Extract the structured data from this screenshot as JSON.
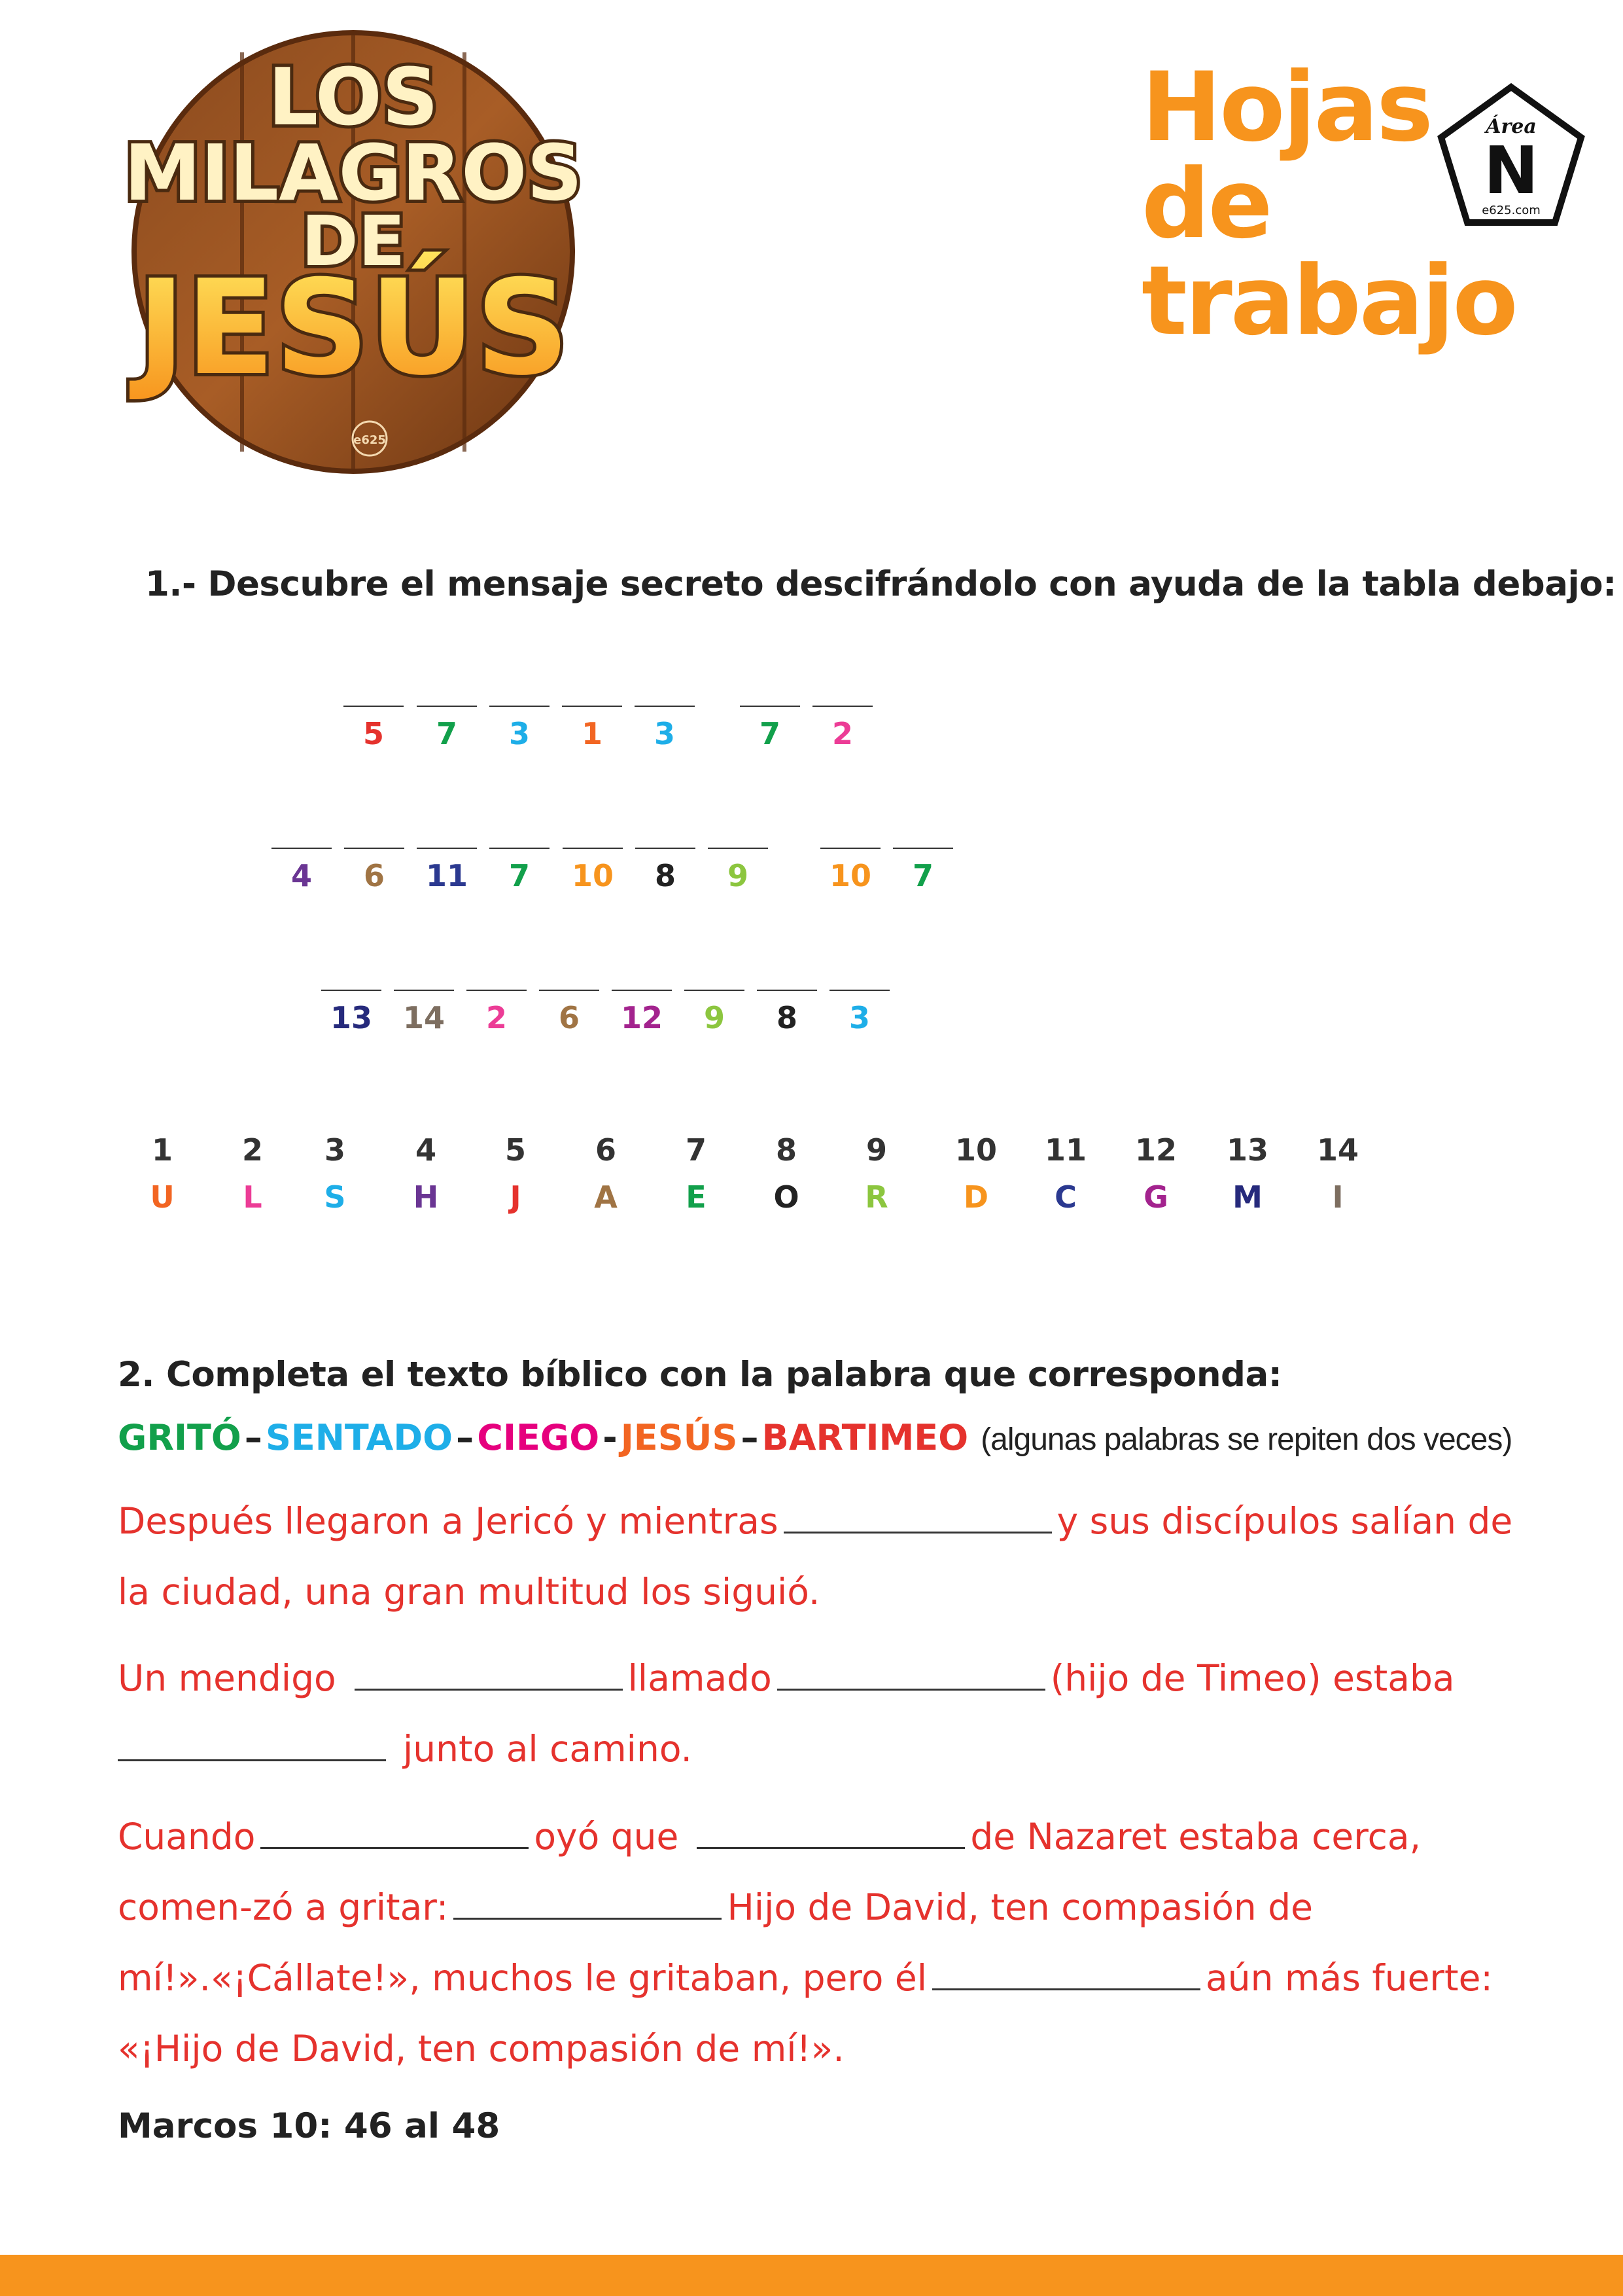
{
  "header": {
    "logo": {
      "line1": "LOS",
      "line2": "MILAGROS",
      "line3": "DE",
      "line4": "JESÚS",
      "mark": "e625"
    },
    "title_lines": [
      "Hojas",
      "de",
      "trabajo"
    ],
    "badge": {
      "top": "Área",
      "letter": "N",
      "bottom": "e625.com"
    }
  },
  "section1": {
    "instruction": "1.- Descubre el mensaje secreto descifrándolo con ayuda de la tabla debajo:",
    "rows": [
      [
        "5",
        "7",
        "3",
        "1",
        "3",
        "7",
        "2"
      ],
      [
        "4",
        "6",
        "11",
        "7",
        "10",
        "8",
        "9",
        "10",
        "7"
      ],
      [
        "13",
        "14",
        "2",
        "6",
        "12",
        "9",
        "8",
        "3"
      ]
    ],
    "key": [
      {
        "num": "1",
        "letter": "U",
        "color": "#f26522"
      },
      {
        "num": "2",
        "letter": "L",
        "color": "#ec3c96"
      },
      {
        "num": "3",
        "letter": "S",
        "color": "#1eaee8"
      },
      {
        "num": "4",
        "letter": "H",
        "color": "#6a3593"
      },
      {
        "num": "5",
        "letter": "J",
        "color": "#e5322d"
      },
      {
        "num": "6",
        "letter": "A",
        "color": "#a07444"
      },
      {
        "num": "7",
        "letter": "E",
        "color": "#12a04b"
      },
      {
        "num": "8",
        "letter": "O",
        "color": "#222222"
      },
      {
        "num": "9",
        "letter": "R",
        "color": "#8cc63f"
      },
      {
        "num": "10",
        "letter": "D",
        "color": "#f7941d"
      },
      {
        "num": "11",
        "letter": "C",
        "color": "#2b3990"
      },
      {
        "num": "12",
        "letter": "G",
        "color": "#a3238e"
      },
      {
        "num": "13",
        "letter": "M",
        "color": "#262a7c"
      },
      {
        "num": "14",
        "letter": "I",
        "color": "#7d6e60"
      }
    ]
  },
  "section2": {
    "instruction": "2. Completa el texto bíblico  con la palabra que corresponda:",
    "words": [
      {
        "text": "GRITÓ",
        "color": "#12a04b"
      },
      {
        "text": "SENTADO",
        "color": "#1eaee8"
      },
      {
        "text": "CIEGO",
        "color": "#e6007e"
      },
      {
        "text": "JESÚS",
        "color": "#f26522"
      },
      {
        "text": "BARTIMEO",
        "color": "#e5322d"
      }
    ],
    "separators": [
      "–",
      "–",
      "-",
      "–"
    ],
    "note": "(algunas palabras se repiten dos veces)",
    "p1": {
      "a": "Después llegaron a Jericó y mientras",
      "b": "y sus discípulos salían de la ciudad, una gran multitud los siguió."
    },
    "p2": {
      "a": "Un mendigo",
      "b": "llamado",
      "c": "(hijo de Timeo) estaba",
      "d": "junto al camino."
    },
    "p3": {
      "a": "Cuando",
      "b": "oyó que",
      "c": "de Nazaret estaba cerca, comen-zó a gritar:",
      "d": "Hijo de David, ten compasión de mí!».«¡Cállate!», muchos le gritaban, pero él",
      "e": "aún más fuerte: «¡Hijo de David, ten compasión de mí!»."
    },
    "reference": "Marcos 10: 46 al 48"
  }
}
